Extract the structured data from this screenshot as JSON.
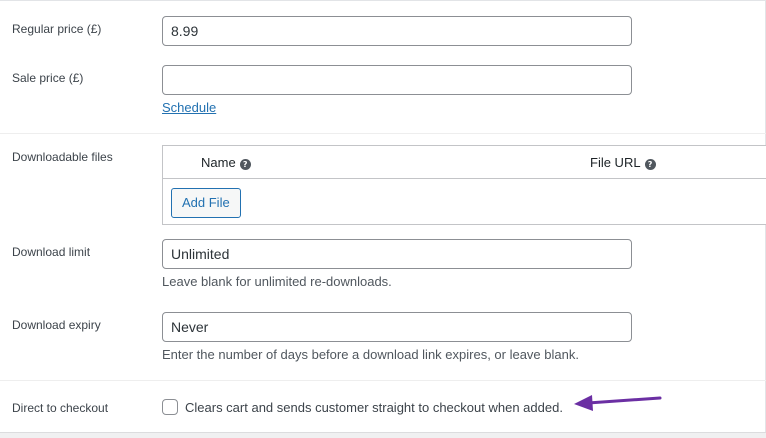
{
  "fields": {
    "regular_price": {
      "label": "Regular price (£)",
      "value": "8.99"
    },
    "sale_price": {
      "label": "Sale price (£)",
      "value": "",
      "schedule_link": "Schedule"
    },
    "downloadable_files": {
      "label": "Downloadable files",
      "columns": [
        {
          "label": "Name",
          "icon": "help-icon"
        },
        {
          "label": "File URL",
          "icon": "help-icon"
        }
      ],
      "add_button": "Add File"
    },
    "download_limit": {
      "label": "Download limit",
      "value": "Unlimited",
      "help": "Leave blank for unlimited re-downloads."
    },
    "download_expiry": {
      "label": "Download expiry",
      "value": "Never",
      "help": "Enter the number of days before a download link expires, or leave blank."
    },
    "direct_to_checkout": {
      "label": "Direct to checkout",
      "checked": false,
      "description": "Clears cart and sends customer straight to checkout when added."
    }
  },
  "colors": {
    "link": "#2271b1",
    "arrow": "#6b2fa3",
    "border": "#8c8f94"
  }
}
